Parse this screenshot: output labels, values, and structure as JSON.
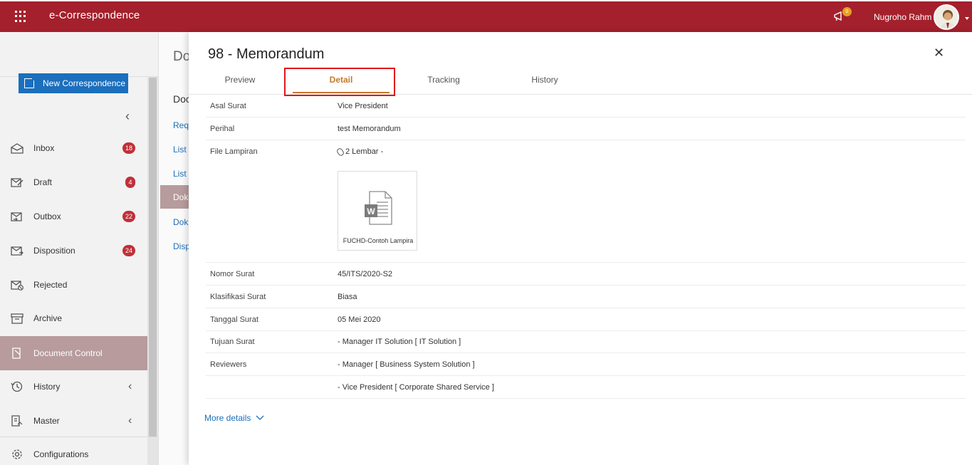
{
  "header": {
    "app_title": "e-Correspondence",
    "notification_count": "0",
    "user_name": "Nugroho Rahm"
  },
  "sidebar": {
    "new_button_label": "New Correspondence",
    "items": [
      {
        "label": "Inbox",
        "icon": "inbox-icon",
        "badge": "18"
      },
      {
        "label": "Draft",
        "icon": "draft-icon",
        "badge": "4"
      },
      {
        "label": "Outbox",
        "icon": "outbox-icon",
        "badge": "22"
      },
      {
        "label": "Disposition",
        "icon": "disposition-icon",
        "badge": "24"
      },
      {
        "label": "Rejected",
        "icon": "rejected-icon"
      },
      {
        "label": "Archive",
        "icon": "archive-icon"
      },
      {
        "label": "Document Control",
        "icon": "document-control-icon",
        "active": true
      },
      {
        "label": "History",
        "icon": "history-icon",
        "expandable": true
      },
      {
        "label": "Master",
        "icon": "master-icon",
        "expandable": true
      },
      {
        "label": "Configurations",
        "icon": "gear-icon"
      }
    ]
  },
  "middle": {
    "title": "Do",
    "subtitle": "Doc",
    "links": [
      "Requ",
      "List",
      "List",
      "Doku",
      "Doku",
      "Disp"
    ]
  },
  "panel": {
    "title": "98 - Memorandum",
    "tabs": [
      "Preview",
      "Detail",
      "Tracking",
      "History"
    ],
    "active_tab": "Detail",
    "fields": {
      "asal_surat": {
        "label": "Asal Surat",
        "value": "Vice President"
      },
      "perihal": {
        "label": "Perihal",
        "value": "test Memorandum"
      },
      "file_lampiran": {
        "label": "File Lampiran",
        "value": "2 Lembar -"
      },
      "nomor_surat": {
        "label": "Nomor Surat",
        "value": "45/ITS/2020-S2"
      },
      "klasifikasi_surat": {
        "label": "Klasifikasi Surat",
        "value": "Biasa"
      },
      "tanggal_surat": {
        "label": "Tanggal Surat",
        "value": "05 Mei 2020"
      },
      "tujuan_surat": {
        "label": "Tujuan Surat",
        "value": "- Manager IT Solution [ IT Solution ]"
      },
      "reviewers": {
        "label": "Reviewers",
        "values": [
          "- Manager [ Business System Solution ]",
          "- Vice President [ Corporate Shared Service ]"
        ]
      }
    },
    "attachment_file_name": "FUCHD-Contoh Lampira",
    "more_details_label": "More details"
  },
  "colors": {
    "brand": "#a4202c",
    "accent_blue": "#1b6fbd",
    "active_tab": "#c47a2e",
    "badge": "#c0303a",
    "highlight": "#e0171a"
  }
}
